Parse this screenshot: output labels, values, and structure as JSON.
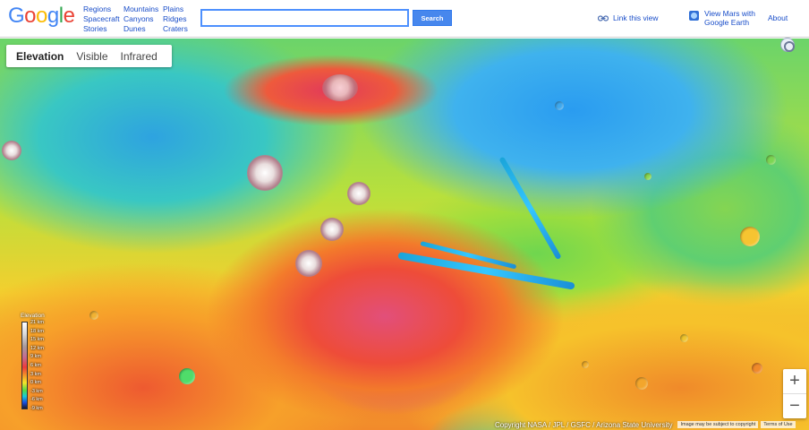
{
  "header": {
    "logo_letters": [
      {
        "char": "G",
        "color": "#4285f4"
      },
      {
        "char": "o",
        "color": "#ea4335"
      },
      {
        "char": "o",
        "color": "#fbbc05"
      },
      {
        "char": "g",
        "color": "#4285f4"
      },
      {
        "char": "l",
        "color": "#34a853"
      },
      {
        "char": "e",
        "color": "#ea4335"
      }
    ],
    "nav_columns": [
      [
        "Regions",
        "Spacecraft",
        "Stories"
      ],
      [
        "Mountains",
        "Canyons",
        "Dunes"
      ],
      [
        "Plains",
        "Ridges",
        "Craters"
      ]
    ],
    "search": {
      "value": "",
      "button_label": "Search"
    },
    "link_view_label": "Link this view",
    "earth_label_line1": "View Mars with",
    "earth_label_line2": "Google Earth",
    "about_label": "About"
  },
  "layer_tabs": [
    {
      "label": "Elevation",
      "active": true
    },
    {
      "label": "Visible",
      "active": false
    },
    {
      "label": "Infrared",
      "active": false
    }
  ],
  "legend": {
    "title": "Elevation",
    "labels": [
      "21 km",
      "18 km",
      "15 km",
      "12 km",
      "9 km",
      "6 km",
      "3 km",
      "0 km",
      "-3 km",
      "-6 km",
      "-9 km"
    ]
  },
  "zoom": {
    "plus": "+",
    "minus": "−"
  },
  "footer": {
    "copyright": "Copyright NASA / JPL / GSFC / Arizona State University",
    "disclaimer": "Image may be subject to copyright",
    "terms": "Terms of Use"
  },
  "icons": {
    "link": "link-icon",
    "earth": "google-earth-icon",
    "compass": "compass-icon"
  },
  "colors": {
    "link_blue": "#1a4ec9",
    "search_button": "#4787ed",
    "search_border": "#4d90fe"
  }
}
